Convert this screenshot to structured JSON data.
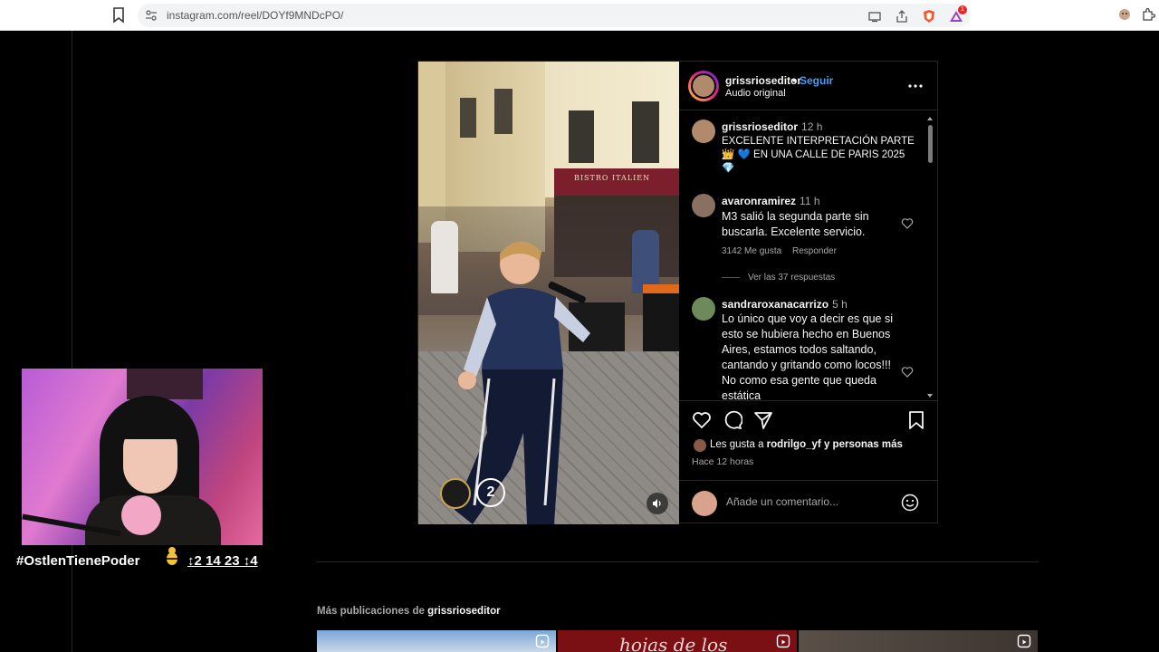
{
  "browser": {
    "url": "instagram.com/reel/DOYf9MNDcPO/",
    "notification_badge": "1"
  },
  "post": {
    "username": "grissrioseditor",
    "separator": "•",
    "follow_label": "Seguir",
    "audio_label": "Audio original",
    "more_label": "..."
  },
  "comments": [
    {
      "username": "grissrioseditor",
      "time": "12 h",
      "text_line1": "EXCELENTE INTERPRETACIÓN PARTE 2",
      "text_line2": "👑 💙 EN UNA CALLE DE PARIS 2025",
      "text_line3": "💎"
    },
    {
      "username": "avaronramirez",
      "time": "11 h",
      "text": "M3 salió la segunda parte sin buscarla. Excelente servicio.",
      "likes": "3142 Me gusta",
      "reply_label": "Responder",
      "view_replies": "Ver las 37 respuestas"
    },
    {
      "username": "sandraroxanacarrizo",
      "time": "5 h",
      "text": "Lo único que voy a decir es que si esto se hubiera hecho en Buenos Aires, estamos todos saltando, cantando y gritando como locos!!! No como esa gente que queda estática"
    }
  ],
  "likes_summary": {
    "prefix": "Les gusta a",
    "user": "rodrilgo_yf",
    "connector": "y",
    "suffix": "personas más"
  },
  "posted_ago": "Hace 12 horas",
  "composer": {
    "placeholder": "Añade un comentario..."
  },
  "video": {
    "part_number": "2",
    "shop_sign": "BISTRO ITALIEN"
  },
  "stream": {
    "hashtag": "#OstlenTienePoder",
    "code": "↕2 14 23 ↕4"
  },
  "more_posts": {
    "prefix": "Más publicaciones de",
    "user": "grissrioseditor",
    "thumb2_text": "hojas de los"
  },
  "colors": {
    "background": "#000000",
    "follow_blue": "#4a9cf5",
    "muted_text": "#a8a8a8",
    "border": "#262626"
  }
}
